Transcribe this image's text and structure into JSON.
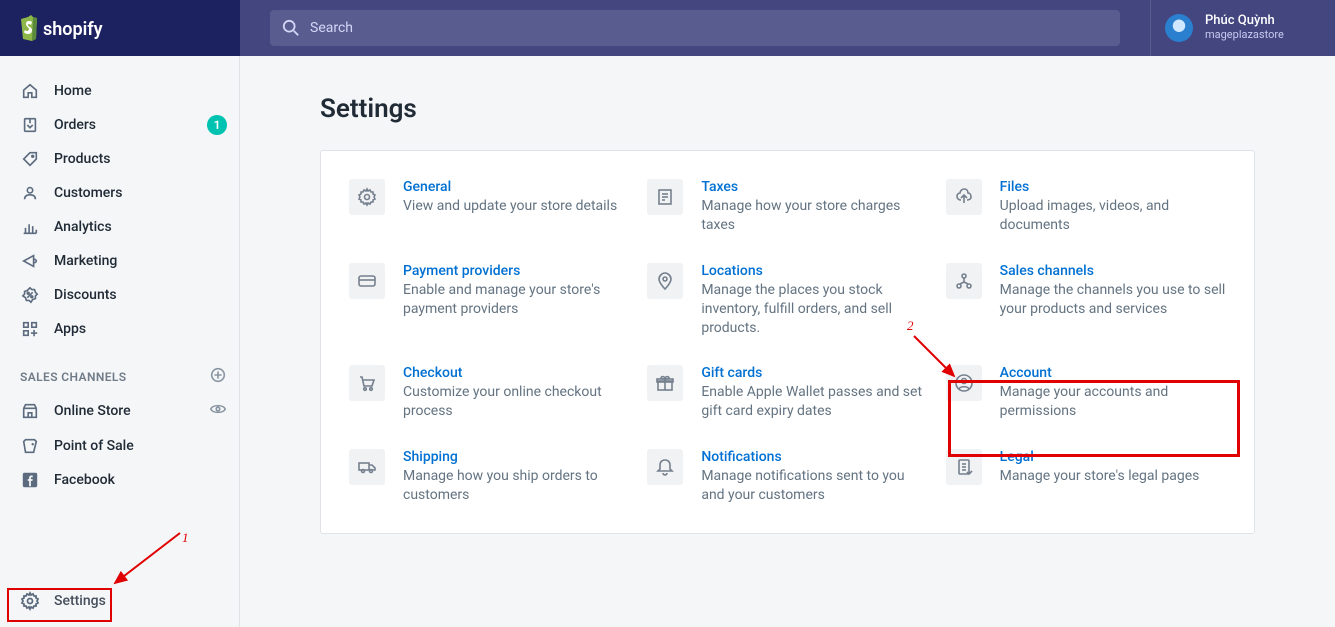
{
  "brand": "shopify",
  "search_placeholder": "Search",
  "user": {
    "name": "Phúc Quỳnh",
    "store": "mageplazastore"
  },
  "sidebar": {
    "items": [
      {
        "label": "Home",
        "icon": "home-icon"
      },
      {
        "label": "Orders",
        "icon": "orders-icon",
        "badge": "1"
      },
      {
        "label": "Products",
        "icon": "products-icon"
      },
      {
        "label": "Customers",
        "icon": "customers-icon"
      },
      {
        "label": "Analytics",
        "icon": "analytics-icon"
      },
      {
        "label": "Marketing",
        "icon": "marketing-icon"
      },
      {
        "label": "Discounts",
        "icon": "discounts-icon"
      },
      {
        "label": "Apps",
        "icon": "apps-icon"
      }
    ],
    "channels_header": "SALES CHANNELS",
    "channels": [
      {
        "label": "Online Store",
        "icon": "store-icon",
        "right": "eye-icon"
      },
      {
        "label": "Point of Sale",
        "icon": "pos-icon"
      },
      {
        "label": "Facebook",
        "icon": "facebook-icon"
      }
    ],
    "settings_label": "Settings"
  },
  "page_title": "Settings",
  "cards": [
    {
      "title": "General",
      "desc": "View and update your store details",
      "icon": "gear-icon"
    },
    {
      "title": "Taxes",
      "desc": "Manage how your store charges taxes",
      "icon": "receipt-icon"
    },
    {
      "title": "Files",
      "desc": "Upload images, videos, and documents",
      "icon": "files-icon"
    },
    {
      "title": "Payment providers",
      "desc": "Enable and manage your store's payment providers",
      "icon": "creditcard-icon"
    },
    {
      "title": "Locations",
      "desc": "Manage the places you stock inventory, fulfill orders, and sell products.",
      "icon": "location-icon"
    },
    {
      "title": "Sales channels",
      "desc": "Manage the channels you use to sell your products and services",
      "icon": "channels-icon"
    },
    {
      "title": "Checkout",
      "desc": "Customize your online checkout process",
      "icon": "cart-icon"
    },
    {
      "title": "Gift cards",
      "desc": "Enable Apple Wallet passes and set gift card expiry dates",
      "icon": "gift-icon"
    },
    {
      "title": "Account",
      "desc": "Manage your accounts and permissions",
      "icon": "account-icon"
    },
    {
      "title": "Shipping",
      "desc": "Manage how you ship orders to customers",
      "icon": "truck-icon"
    },
    {
      "title": "Notifications",
      "desc": "Manage notifications sent to you and your customers",
      "icon": "bell-icon"
    },
    {
      "title": "Legal",
      "desc": "Manage your store's legal pages",
      "icon": "legal-icon"
    }
  ],
  "annotations": {
    "callout1": "1",
    "callout2": "2"
  }
}
